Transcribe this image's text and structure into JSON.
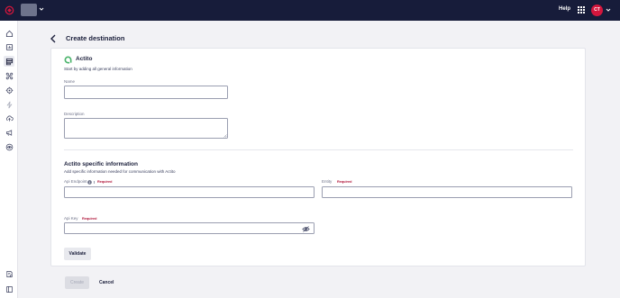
{
  "header": {
    "help_label": "Help",
    "user_initials": "CT",
    "brand_color": "#d4163d"
  },
  "sidebar": {
    "items": [
      {
        "icon": "home-icon"
      },
      {
        "icon": "dashboard-icon"
      },
      {
        "icon": "database-icon",
        "active": true
      },
      {
        "icon": "connections-icon"
      },
      {
        "icon": "target-icon"
      },
      {
        "icon": "bolt-icon"
      },
      {
        "icon": "cloud-upload-icon"
      },
      {
        "icon": "megaphone-icon"
      },
      {
        "icon": "eye-circle-icon"
      },
      {
        "icon": "document-settings-icon"
      },
      {
        "icon": "sidebar-toggle-icon"
      }
    ]
  },
  "page": {
    "title": "Create destination"
  },
  "destination": {
    "name": "Actito",
    "intro": "Start by adding all general information",
    "name_label": "Name",
    "name_value": "",
    "description_label": "Description",
    "description_value": ""
  },
  "specific": {
    "title": "Actito specific information",
    "subtitle": "Add specific information needed for communication with Actito",
    "api_endpoint_label": "Api Endpoint",
    "entity_label": "Entity",
    "api_key_label": "Api Key",
    "required_label": "Required",
    "api_endpoint_value": "",
    "entity_value": "",
    "api_key_value": "",
    "validate_label": "Validate"
  },
  "footer": {
    "create_label": "Create",
    "cancel_label": "Cancel"
  }
}
